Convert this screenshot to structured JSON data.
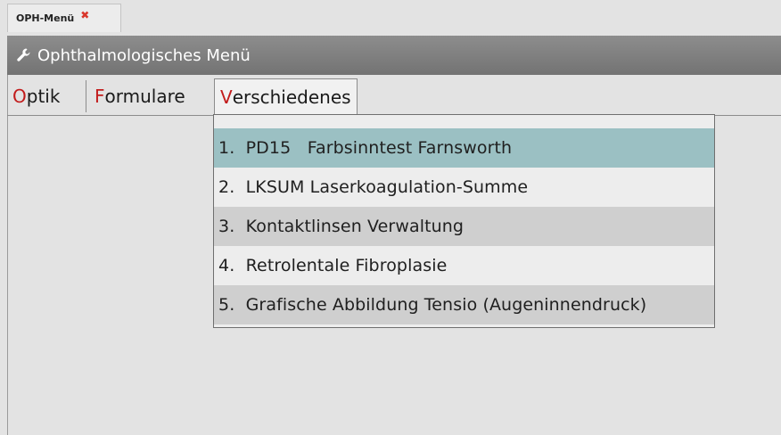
{
  "doc_tab": {
    "label": "OPH-Menü",
    "close_glyph": "✖"
  },
  "window": {
    "title": "Ophthalmologisches Menü",
    "icon": "wrench-icon"
  },
  "menubar": {
    "tabs": [
      {
        "mnemonic": "O",
        "rest": "ptik"
      },
      {
        "mnemonic": "F",
        "rest": "ormulare"
      },
      {
        "mnemonic": "V",
        "rest": "erschiedenes"
      }
    ],
    "active_tab_index": 2
  },
  "dropdown": {
    "items": [
      {
        "label": "1.  PD15   Farbsinntest Farnsworth",
        "state": "highlighted"
      },
      {
        "label": "2.  LKSUM Laserkoagulation-Summe",
        "state": "normal"
      },
      {
        "label": "3.  Kontaktlinsen Verwaltung",
        "state": "alternate"
      },
      {
        "label": "4.  Retrolentale Fibroplasie",
        "state": "normal"
      },
      {
        "label": "5.  Grafische Abbildung Tensio (Augeninnendruck)",
        "state": "alternate"
      }
    ]
  },
  "colors": {
    "background": "#e3e3e3",
    "titlebar": "#808080",
    "mnemonic": "#c21c1c",
    "highlight": "#9bc0c3",
    "alternate_row": "#cfcfcf",
    "close_x": "#d9362b"
  }
}
